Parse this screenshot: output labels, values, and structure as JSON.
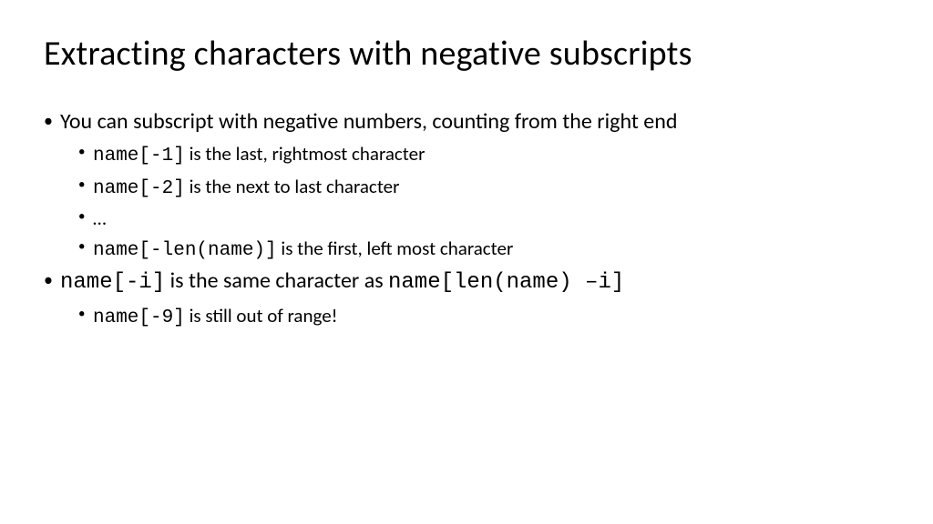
{
  "title": "Extracting characters with negative subscripts",
  "b1": "You can subscript with negative numbers, counting from the right end",
  "s1_code": "name[-1]",
  "s1_text": " is the last, rightmost character",
  "s2_code": "name[-2]",
  "s2_text": " is the next to last character",
  "s3_text": "…",
  "s4_code": "name[-len(name)]",
  "s4_text": "  is the first, left most character",
  "b2_code1": "name[-i]",
  "b2_mid": "  is the same character as ",
  "b2_code2": "name[len(name) –i]",
  "s5_code": "name[-9]",
  "s5_text": "  is still out of range!"
}
